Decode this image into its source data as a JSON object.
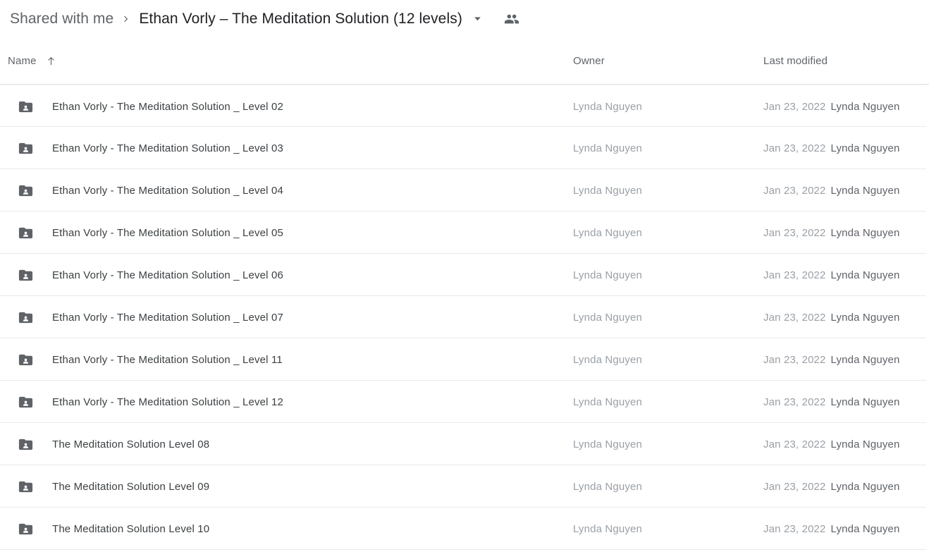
{
  "breadcrumb": {
    "parent_label": "Shared with me",
    "separator": "chevron-right-icon",
    "current_label": "Ethan Vorly – The Meditation Solution (12 levels)",
    "caret": "chevron-down-icon",
    "people_icon": "people-icon"
  },
  "columns": {
    "name": "Name",
    "sort_icon": "arrow-up-icon",
    "owner": "Owner",
    "last_modified": "Last modified"
  },
  "colors": {
    "text_primary": "#3c4043",
    "text_secondary": "#5f6368",
    "text_muted": "#9aa0a6",
    "divider": "#e8eaed",
    "icon": "#5f6368",
    "background": "#ffffff"
  },
  "rows": [
    {
      "icon": "shared-folder-icon",
      "name": "Ethan Vorly - The Meditation Solution _ Level 02",
      "owner": "Lynda Nguyen",
      "modified_date": "Jan 23, 2022",
      "modified_by": "Lynda Nguyen"
    },
    {
      "icon": "shared-folder-icon",
      "name": "Ethan Vorly - The Meditation Solution _ Level 03",
      "owner": "Lynda Nguyen",
      "modified_date": "Jan 23, 2022",
      "modified_by": "Lynda Nguyen"
    },
    {
      "icon": "shared-folder-icon",
      "name": "Ethan Vorly - The Meditation Solution _ Level 04",
      "owner": "Lynda Nguyen",
      "modified_date": "Jan 23, 2022",
      "modified_by": "Lynda Nguyen"
    },
    {
      "icon": "shared-folder-icon",
      "name": "Ethan Vorly - The Meditation Solution _ Level 05",
      "owner": "Lynda Nguyen",
      "modified_date": "Jan 23, 2022",
      "modified_by": "Lynda Nguyen"
    },
    {
      "icon": "shared-folder-icon",
      "name": "Ethan Vorly - The Meditation Solution _ Level 06",
      "owner": "Lynda Nguyen",
      "modified_date": "Jan 23, 2022",
      "modified_by": "Lynda Nguyen"
    },
    {
      "icon": "shared-folder-icon",
      "name": "Ethan Vorly - The Meditation Solution _ Level 07",
      "owner": "Lynda Nguyen",
      "modified_date": "Jan 23, 2022",
      "modified_by": "Lynda Nguyen"
    },
    {
      "icon": "shared-folder-icon",
      "name": "Ethan Vorly - The Meditation Solution _ Level 11",
      "owner": "Lynda Nguyen",
      "modified_date": "Jan 23, 2022",
      "modified_by": "Lynda Nguyen"
    },
    {
      "icon": "shared-folder-icon",
      "name": "Ethan Vorly - The Meditation Solution _ Level 12",
      "owner": "Lynda Nguyen",
      "modified_date": "Jan 23, 2022",
      "modified_by": "Lynda Nguyen"
    },
    {
      "icon": "shared-folder-icon",
      "name": "The Meditation Solution Level 08",
      "owner": "Lynda Nguyen",
      "modified_date": "Jan 23, 2022",
      "modified_by": "Lynda Nguyen"
    },
    {
      "icon": "shared-folder-icon",
      "name": "The Meditation Solution Level 09",
      "owner": "Lynda Nguyen",
      "modified_date": "Jan 23, 2022",
      "modified_by": "Lynda Nguyen"
    },
    {
      "icon": "shared-folder-icon",
      "name": "The Meditation Solution Level 10",
      "owner": "Lynda Nguyen",
      "modified_date": "Jan 23, 2022",
      "modified_by": "Lynda Nguyen"
    }
  ]
}
